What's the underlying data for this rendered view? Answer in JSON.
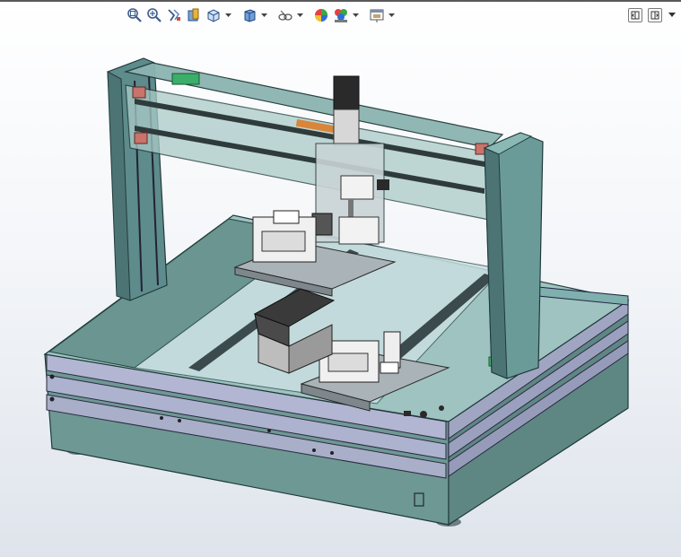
{
  "toolbar": {
    "icons": [
      "zoom-to-fit-icon",
      "zoom-to-area-icon",
      "previous-view-icon",
      "section-view-icon",
      "view-orientation-icon",
      "display-style-icon",
      "hide-show-items-icon",
      "edit-appearance-icon",
      "apply-scene-icon",
      "view-settings-icon"
    ]
  },
  "window_controls": [
    "split-horizontal-icon",
    "split-vertical-icon",
    "expand-icon"
  ],
  "colors": {
    "frame": "#5e8b8b",
    "frame_dark": "#2f5252",
    "panel_blue": "#a9aec9",
    "base_side": "#6d9692",
    "glass": "#c7dcdc",
    "rail_dark": "#3a3a3a",
    "motor": "#2a2a2a",
    "gripper": "#f0f0f0",
    "tray": "#bfc7cb",
    "accent_orange": "#d9863a",
    "accent_green": "#39b36a"
  }
}
